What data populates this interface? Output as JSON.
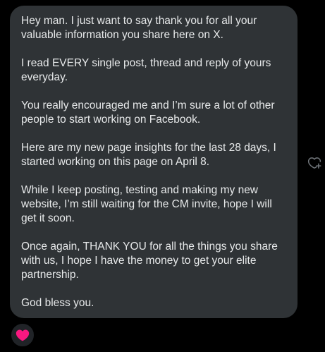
{
  "message": {
    "paragraphs": [
      "Hey man. I just want to say thank you for all your valuable information you share here on X.",
      "I read EVERY single post, thread and reply of yours everyday.",
      "You really encouraged me and I’m sure a lot of other people to start working on Facebook.",
      "Here are my new page insights for the last 28 days, I started working on this page on April 8.",
      "While I keep posting, testing and making my new website, I’m still waiting for the CM invite, hope I will get it soon.",
      "Once again, THANK YOU for all the things you share with us, I hope I have the money to get your elite partnership.",
      "God bless you."
    ]
  },
  "reaction": {
    "add_icon": "add-reaction-heart-plus-icon",
    "existing_icon": "heart-icon",
    "existing_color": "#f91880"
  },
  "colors": {
    "background": "#000000",
    "bubble": "#2f3336",
    "text": "#e7e9ea",
    "icon_gray": "#71767b"
  }
}
